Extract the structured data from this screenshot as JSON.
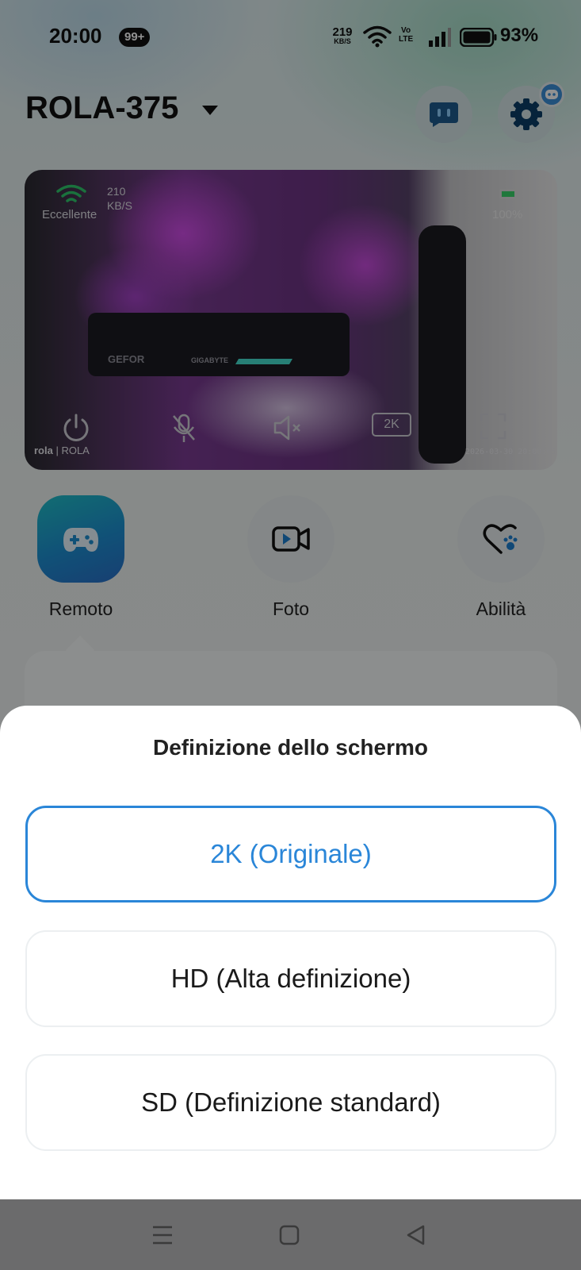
{
  "status_bar": {
    "time": "20:00",
    "notification_badge": "99+",
    "net_speed_value": "219",
    "net_speed_unit": "KB/S",
    "volte_top": "Vo",
    "volte_bottom": "LTE",
    "battery": "93%"
  },
  "header": {
    "device_name": "ROLA-375",
    "icons": [
      "caret-down-icon",
      "chat-icon",
      "gear-icon",
      "robot-badge-icon"
    ]
  },
  "camera": {
    "connection_quality": "Eccellente",
    "stream_speed_value": "210",
    "stream_speed_unit": "KB/S",
    "device_battery": "100%",
    "gpu_text_1": "GEFOR",
    "gpu_text_2": "GIGABYTE",
    "resolution_button": "2K",
    "logo_brand": "rola",
    "logo_text": "ROLA",
    "timestamp": "2026-03-30 20:00:05"
  },
  "actions": [
    {
      "label": "Remoto",
      "icon": "gamepad-icon",
      "active": true
    },
    {
      "label": "Foto",
      "icon": "video-camera-icon",
      "active": false
    },
    {
      "label": "Abilità",
      "icon": "heart-paw-icon",
      "active": false
    }
  ],
  "sheet": {
    "title": "Definizione dello schermo",
    "options": [
      {
        "label": "2K (Originale)",
        "selected": true
      },
      {
        "label": "HD (Alta definizione)",
        "selected": false
      },
      {
        "label": "SD (Definizione standard)",
        "selected": false
      }
    ]
  },
  "colors": {
    "accent": "#2a86d8",
    "active_action_gradient_start": "#20c0c8",
    "active_action_gradient_end": "#2a6fc9",
    "scrim": "#000000",
    "navbar": "#6b6b6c"
  },
  "navbar": {
    "icons": [
      "menu-icon",
      "home-icon",
      "back-icon"
    ]
  }
}
